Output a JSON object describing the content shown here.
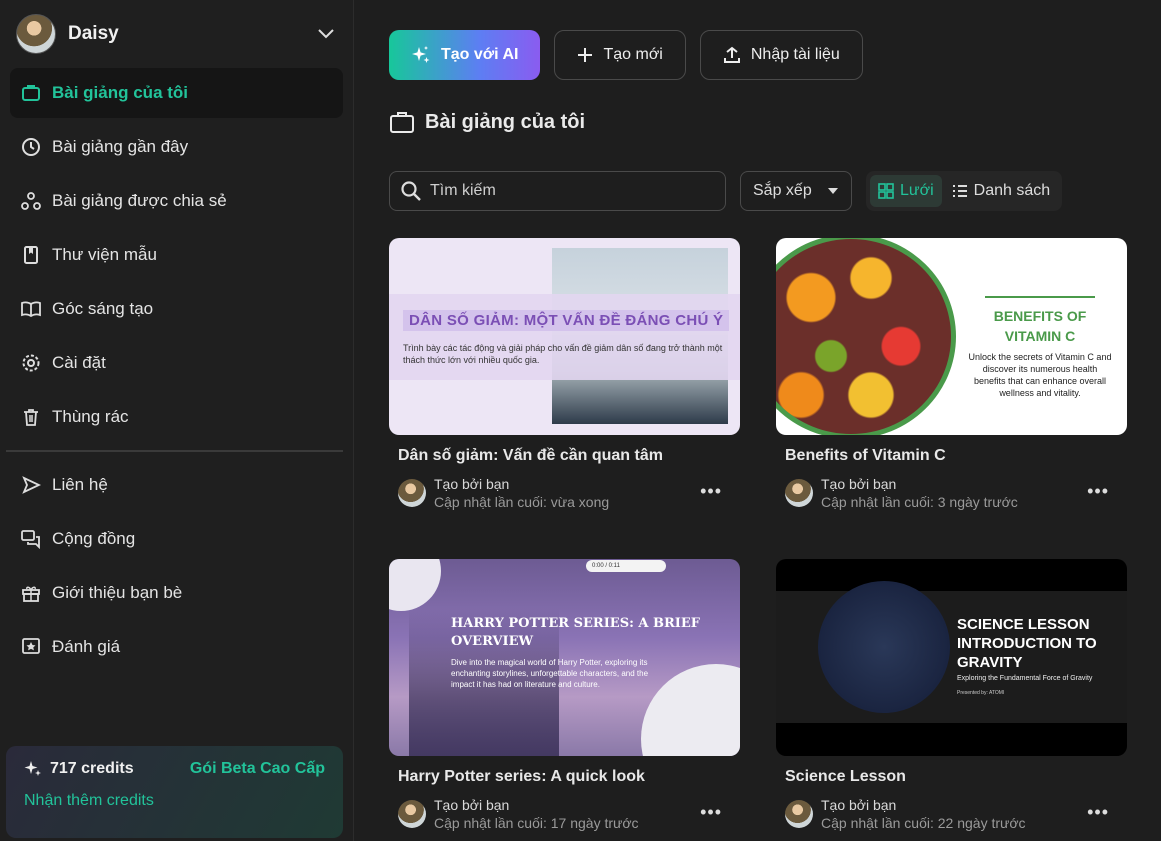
{
  "user": {
    "name": "Daisy"
  },
  "sidebar": {
    "items": [
      {
        "label": "Bài giảng của tôi",
        "icon": "briefcase-icon",
        "active": true
      },
      {
        "label": "Bài giảng gần đây",
        "icon": "clock-icon"
      },
      {
        "label": "Bài giảng được chia sẻ",
        "icon": "share-nodes-icon"
      },
      {
        "label": "Thư viện mẫu",
        "icon": "bookmark-book-icon"
      },
      {
        "label": "Góc sáng tạo",
        "icon": "open-book-icon"
      },
      {
        "label": "Cài đặt",
        "icon": "gear-icon"
      },
      {
        "label": "Thùng rác",
        "icon": "trash-icon"
      }
    ],
    "secondary": [
      {
        "label": "Liên hệ",
        "icon": "send-icon"
      },
      {
        "label": "Cộng đồng",
        "icon": "chat-icon"
      },
      {
        "label": "Giới thiệu bạn bè",
        "icon": "gift-icon"
      },
      {
        "label": "Đánh giá",
        "icon": "star-icon"
      }
    ]
  },
  "credits": {
    "amount": "717 credits",
    "plan": "Gói Beta Cao Cấp",
    "more": "Nhận thêm credits"
  },
  "toolbar": {
    "ai_label": "Tạo với AI",
    "new_label": "Tạo mới",
    "import_label": "Nhập tài liệu"
  },
  "page": {
    "title": "Bài giảng của tôi"
  },
  "search": {
    "placeholder": "Tìm kiếm"
  },
  "sort": {
    "label": "Sắp xếp"
  },
  "view": {
    "grid": "Lưới",
    "list": "Danh sách",
    "selected": "grid"
  },
  "cards": [
    {
      "title": "Dân số giảm: Vấn đề cần quan tâm",
      "by": "Tạo bởi bạn",
      "updated": "Cập nhật lần cuối: vừa xong",
      "thumb_head": "DÂN SỐ GIẢM: MỘT VẤN ĐỀ ĐÁNG CHÚ Ý",
      "thumb_sub": "Trình bày các tác động và giải pháp cho vấn đề giảm dân số đang trở thành một thách thức lớn với nhiều quốc gia."
    },
    {
      "title": "Benefits of Vitamin C",
      "by": "Tạo bởi bạn",
      "updated": "Cập nhật lần cuối: 3 ngày trước",
      "thumb_head": "BENEFITS OF VITAMIN C",
      "thumb_sub": "Unlock the secrets of Vitamin C and discover its numerous health benefits that can enhance overall wellness and vitality."
    },
    {
      "title": "Harry Potter series: A quick look",
      "by": "Tạo bởi bạn",
      "updated": "Cập nhật lần cuối: 17 ngày trước",
      "thumb_head": "HARRY POTTER SERIES: A BRIEF OVERVIEW",
      "thumb_sub": "Dive into the magical world of Harry Potter, exploring its enchanting storylines, unforgettable characters, and the impact it has had on literature and culture.",
      "thumb_player": "0:00 / 0:11"
    },
    {
      "title": "Science Lesson",
      "by": "Tạo bởi bạn",
      "updated": "Cập nhật lần cuối: 22 ngày trước",
      "thumb_head": "SCIENCE LESSON INTRODUCTION TO GRAVITY",
      "thumb_sub": "Exploring the Fundamental Force of Gravity",
      "thumb_pres": "Presented by: ATOMI"
    }
  ],
  "colors": {
    "accent": "#22c39a",
    "bg": "#1e1e1e",
    "sidebar": "#1f1f1f"
  }
}
